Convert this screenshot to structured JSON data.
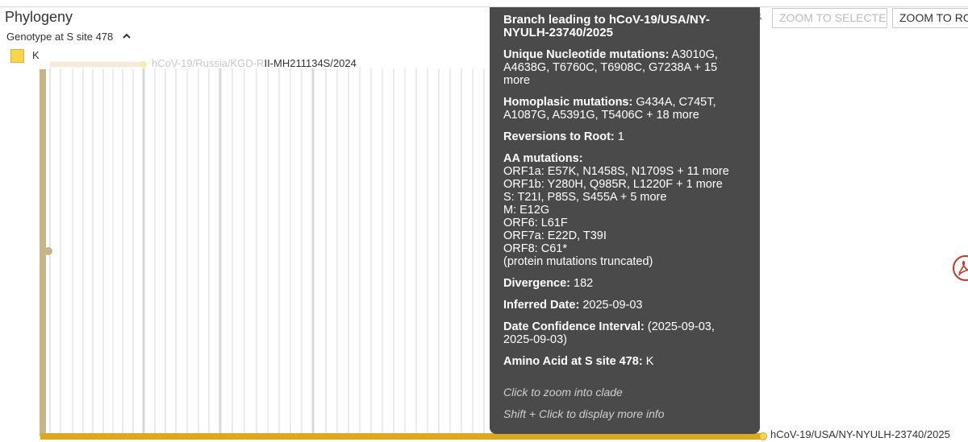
{
  "panel": {
    "title": "Phylogeny",
    "legend_title": "Genotype at S site 478",
    "legend_items": [
      {
        "label": "K",
        "color": "#fbd54c"
      }
    ]
  },
  "toolbar": {
    "zoom_selected_label": "ZOOM TO SELECTED",
    "zoom_root_label": "ZOOM TO ROOT"
  },
  "tree": {
    "tip_top_faded": "hCoV-19/Russia/KGD-R",
    "tip_top_dark": "II-MH211134S/2024",
    "tip_bottom": "hCoV-19/USA/NY-NYULH-23740/2025",
    "colors": {
      "trunk": "#c7b488",
      "branch": "#d9a924",
      "faint": "#e6e6e6"
    }
  },
  "tooltip": {
    "heading": "Branch leading to hCoV-19/USA/NY-NYULH-23740/2025",
    "unique_label": "Unique Nucleotide mutations:",
    "unique_value": "A3010G, A4638G, T6760C, T6908C, G7238A + 15 more",
    "homoplasic_label": "Homoplasic mutations:",
    "homoplasic_value": "G434A, C745T, A1087G, A5391G, T5406C + 18 more",
    "reversions_label": "Reversions to Root:",
    "reversions_value": "1",
    "aa_label": "AA mutations:",
    "aa_lines": [
      "ORF1a:  E57K, N1458S, N1709S + 11 more",
      "ORF1b:  Y280H, Q985R, L1220F + 1 more",
      "S:  T21I, P85S, S455A + 5 more",
      "M:  E12G",
      "ORF6:  L61F",
      "ORF7a:  E22D, T39I",
      "ORF8:  C61*",
      "(protein mutations truncated)"
    ],
    "divergence_label": "Divergence:",
    "divergence_value": "182",
    "date_label": "Inferred Date:",
    "date_value": "2025-09-03",
    "ci_label": "Date Confidence Interval:",
    "ci_value": "(2025-09-03, 2025-09-03)",
    "aa_site_label": "Amino Acid at S site 478:",
    "aa_site_value": "K",
    "hint_click": "Click to zoom into clade",
    "hint_shift": "Shift + Click to display more info"
  }
}
